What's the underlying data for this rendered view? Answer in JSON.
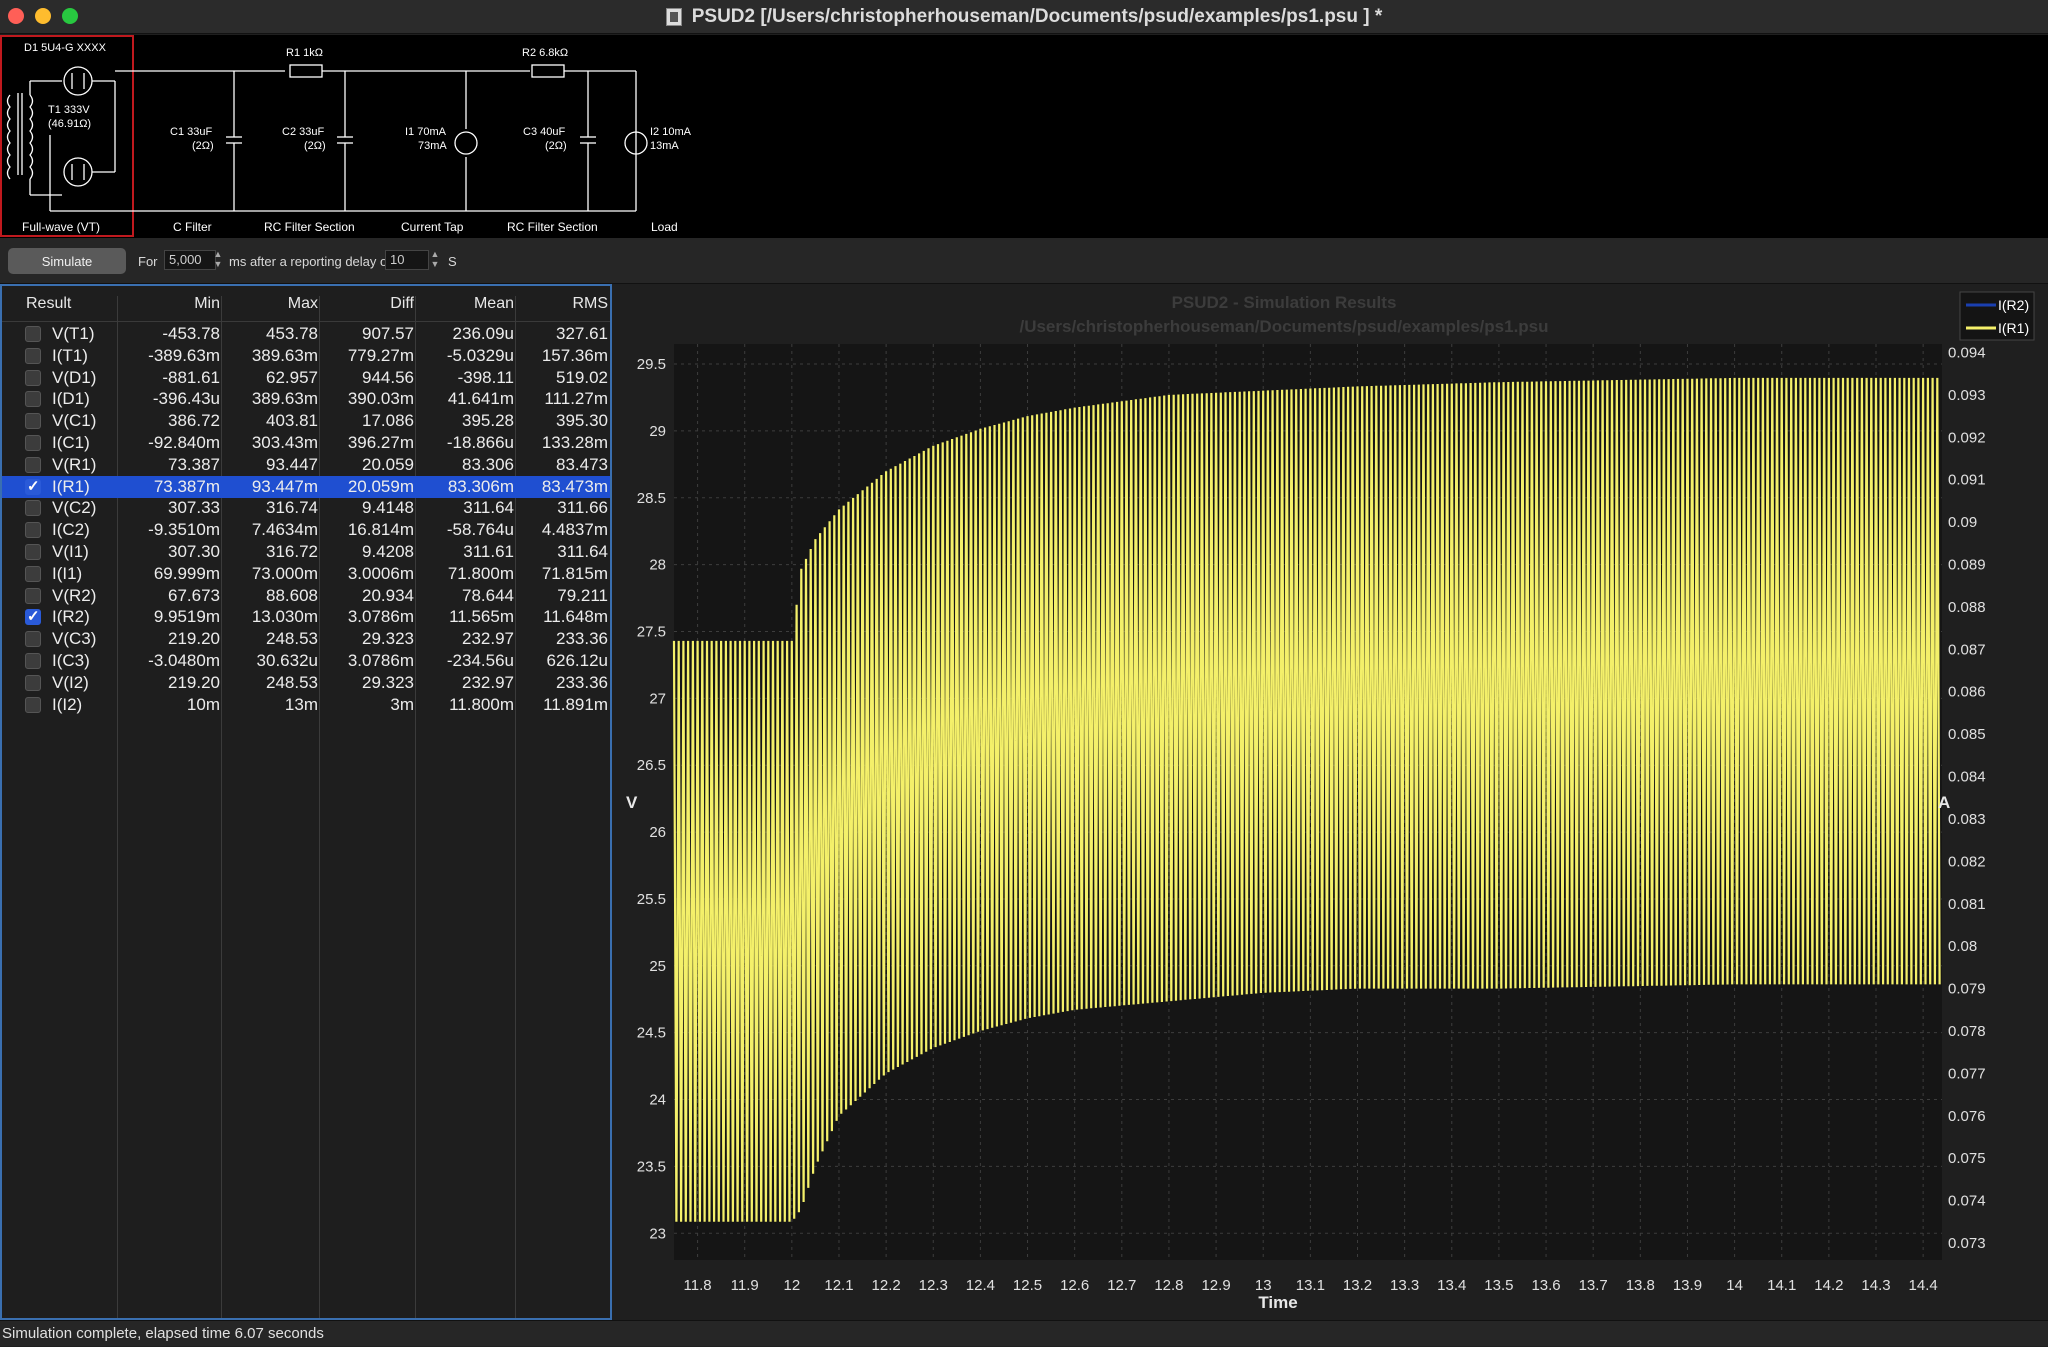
{
  "window": {
    "title": "PSUD2  [/Users/christopherhouseman/Documents/psud/examples/ps1.psu ] *",
    "colors": {
      "close": "#ff5f57",
      "minimize": "#febc2e",
      "zoom": "#28c840"
    }
  },
  "schematic": {
    "labels": {
      "d1": "D1 5U4-G XXXX",
      "t1_a": "T1 333V",
      "t1_b": "(46.91Ω)",
      "r1": "R1 1kΩ",
      "r2": "R2 6.8kΩ",
      "c1_a": "C1 33uF",
      "c1_b": "(2Ω)",
      "c2_a": "C2 33uF",
      "c2_b": "(2Ω)",
      "i1_a": "I1 70mA",
      "i1_b": "73mA",
      "c3_a": "C3 40uF",
      "c3_b": "(2Ω)",
      "i2_a": "I2 10mA",
      "i2_b": "13mA"
    },
    "stages": [
      "Full-wave (VT)",
      "C Filter",
      "RC Filter Section",
      "Current Tap",
      "RC Filter Section",
      "Load"
    ]
  },
  "simbar": {
    "simulate_label": "Simulate",
    "for_label": "For",
    "duration_value": "5,000",
    "ms_label": "ms after a reporting delay of",
    "delay_value": "10",
    "s_label": "S"
  },
  "results": {
    "headers": [
      "Result",
      "Min",
      "Max",
      "Diff",
      "Mean",
      "RMS"
    ],
    "rows": [
      {
        "name": "V(T1)",
        "checked": false,
        "min": "-453.78",
        "max": "453.78",
        "diff": "907.57",
        "mean": "236.09u",
        "rms": "327.61"
      },
      {
        "name": "I(T1)",
        "checked": false,
        "min": "-389.63m",
        "max": "389.63m",
        "diff": "779.27m",
        "mean": "-5.0329u",
        "rms": "157.36m"
      },
      {
        "name": "V(D1)",
        "checked": false,
        "min": "-881.61",
        "max": "62.957",
        "diff": "944.56",
        "mean": "-398.11",
        "rms": "519.02"
      },
      {
        "name": "I(D1)",
        "checked": false,
        "min": "-396.43u",
        "max": "389.63m",
        "diff": "390.03m",
        "mean": "41.641m",
        "rms": "111.27m"
      },
      {
        "name": "V(C1)",
        "checked": false,
        "min": "386.72",
        "max": "403.81",
        "diff": "17.086",
        "mean": "395.28",
        "rms": "395.30"
      },
      {
        "name": "I(C1)",
        "checked": false,
        "min": "-92.840m",
        "max": "303.43m",
        "diff": "396.27m",
        "mean": "-18.866u",
        "rms": "133.28m"
      },
      {
        "name": "V(R1)",
        "checked": false,
        "min": "73.387",
        "max": "93.447",
        "diff": "20.059",
        "mean": "83.306",
        "rms": "83.473"
      },
      {
        "name": "I(R1)",
        "checked": true,
        "selected": true,
        "min": "73.387m",
        "max": "93.447m",
        "diff": "20.059m",
        "mean": "83.306m",
        "rms": "83.473m"
      },
      {
        "name": "V(C2)",
        "checked": false,
        "min": "307.33",
        "max": "316.74",
        "diff": "9.4148",
        "mean": "311.64",
        "rms": "311.66"
      },
      {
        "name": "I(C2)",
        "checked": false,
        "min": "-9.3510m",
        "max": "7.4634m",
        "diff": "16.814m",
        "mean": "-58.764u",
        "rms": "4.4837m"
      },
      {
        "name": "V(I1)",
        "checked": false,
        "min": "307.30",
        "max": "316.72",
        "diff": "9.4208",
        "mean": "311.61",
        "rms": "311.64"
      },
      {
        "name": "I(I1)",
        "checked": false,
        "min": "69.999m",
        "max": "73.000m",
        "diff": "3.0006m",
        "mean": "71.800m",
        "rms": "71.815m"
      },
      {
        "name": "V(R2)",
        "checked": false,
        "min": "67.673",
        "max": "88.608",
        "diff": "20.934",
        "mean": "78.644",
        "rms": "79.211"
      },
      {
        "name": "I(R2)",
        "checked": true,
        "min": "9.9519m",
        "max": "13.030m",
        "diff": "3.0786m",
        "mean": "11.565m",
        "rms": "11.648m"
      },
      {
        "name": "V(C3)",
        "checked": false,
        "min": "219.20",
        "max": "248.53",
        "diff": "29.323",
        "mean": "232.97",
        "rms": "233.36"
      },
      {
        "name": "I(C3)",
        "checked": false,
        "min": "-3.0480m",
        "max": "30.632u",
        "diff": "3.0786m",
        "mean": "-234.56u",
        "rms": "626.12u"
      },
      {
        "name": "V(I2)",
        "checked": false,
        "min": "219.20",
        "max": "248.53",
        "diff": "29.323",
        "mean": "232.97",
        "rms": "233.36"
      },
      {
        "name": "I(I2)",
        "checked": false,
        "min": "10m",
        "max": "13m",
        "diff": "3m",
        "mean": "11.800m",
        "rms": "11.891m"
      }
    ]
  },
  "chart_data": {
    "type": "line",
    "title": "PSUD2 - Simulation Results",
    "subtitle": "/Users/christopherhouseman/Documents/psud/examples/ps1.psu",
    "xlabel": "Time",
    "ylabel_left": "V",
    "ylabel_right": "A",
    "xlim": [
      11.75,
      14.44
    ],
    "ylim_left": [
      22.8,
      29.65
    ],
    "ylim_right": [
      0.0726,
      0.0942
    ],
    "x_ticks": [
      "11.8",
      "11.9",
      "12",
      "12.1",
      "12.2",
      "12.3",
      "12.4",
      "12.5",
      "12.6",
      "12.7",
      "12.8",
      "12.9",
      "13",
      "13.1",
      "13.2",
      "13.3",
      "13.4",
      "13.5",
      "13.6",
      "13.7",
      "13.8",
      "13.9",
      "14",
      "14.1",
      "14.2",
      "14.3",
      "14.4"
    ],
    "y_ticks_left": [
      "23",
      "23.5",
      "24",
      "24.5",
      "25",
      "25.5",
      "26",
      "26.5",
      "27",
      "27.5",
      "28",
      "28.5",
      "29",
      "29.5"
    ],
    "y_ticks_right": [
      "0.073",
      "0.074",
      "0.075",
      "0.076",
      "0.077",
      "0.078",
      "0.079",
      "0.08",
      "0.081",
      "0.082",
      "0.083",
      "0.084",
      "0.085",
      "0.086",
      "0.087",
      "0.088",
      "0.089",
      "0.09",
      "0.091",
      "0.092",
      "0.093",
      "0.094"
    ],
    "grid": true,
    "legend_position": "top-right",
    "series": [
      {
        "name": "I(R2)",
        "color": "#1a3fb0",
        "axis": "left",
        "visible_in_range": false
      },
      {
        "name": "I(R1)",
        "color": "#f4f06a",
        "axis": "right",
        "envelope": {
          "x": [
            11.75,
            12.0,
            12.02,
            12.05,
            12.1,
            12.2,
            12.3,
            12.4,
            12.5,
            12.6,
            12.8,
            13.0,
            13.2,
            13.5,
            14.0,
            14.44
          ],
          "max": [
            0.0872,
            0.0872,
            0.0889,
            0.0896,
            0.0903,
            0.0912,
            0.0918,
            0.0922,
            0.0925,
            0.0927,
            0.093,
            0.0931,
            0.0932,
            0.0933,
            0.0934,
            0.0934
          ],
          "min": [
            0.0735,
            0.0735,
            0.0738,
            0.0748,
            0.076,
            0.077,
            0.0776,
            0.078,
            0.0783,
            0.0785,
            0.0787,
            0.0789,
            0.079,
            0.079,
            0.0791,
            0.0791
          ]
        },
        "cycle_period": 0.01
      }
    ]
  },
  "status": {
    "text": "Simulation complete, elapsed time 6.07 seconds"
  }
}
